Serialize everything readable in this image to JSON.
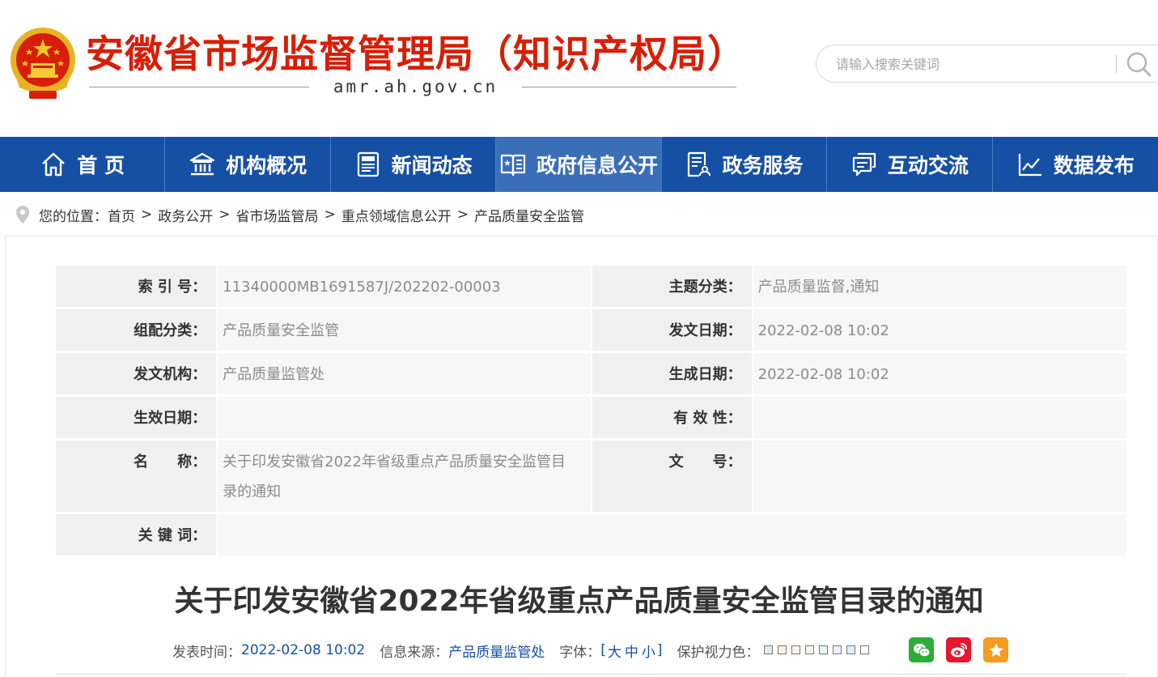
{
  "header": {
    "title": "安徽省市场监督管理局（知识产权局）",
    "domain": "amr.ah.gov.cn",
    "search": {
      "placeholder": "请输入搜索关键词"
    }
  },
  "nav": {
    "items": [
      {
        "label": "首 页",
        "icon": "home-icon"
      },
      {
        "label": "机构概况",
        "icon": "building-icon"
      },
      {
        "label": "新闻动态",
        "icon": "news-icon"
      },
      {
        "label": "政府信息公开",
        "icon": "open-book-icon",
        "active": true
      },
      {
        "label": "政务服务",
        "icon": "service-doc-icon"
      },
      {
        "label": "互动交流",
        "icon": "chat-icon"
      },
      {
        "label": "数据发布",
        "icon": "chart-icon"
      }
    ]
  },
  "breadcrumb": {
    "prefix": "您的位置：",
    "items": [
      "首页",
      "政务公开",
      "省市场监管局",
      "重点领域信息公开",
      "产品质量安全监管"
    ],
    "separator": ">"
  },
  "info": {
    "index_no_label": "索 引 号：",
    "index_no": "11340000MB1691587J/202202-00003",
    "topic_label": "主题分类：",
    "topic": "产品质量监督,通知",
    "category_label": "组配分类：",
    "category": "产品质量安全监管",
    "issue_date_label": "发文日期：",
    "issue_date": "2022-02-08 10:02",
    "issuer_label": "发文机构：",
    "issuer": "产品质量监管处",
    "created_label": "生成日期：",
    "created": "2022-02-08 10:02",
    "effective_label": "生效日期：",
    "effective": "",
    "validity_label": "有 效 性：",
    "validity": "",
    "name_label": "名　　称：",
    "name": "关于印发安徽省2022年省级重点产品质量安全监管目录的通知",
    "doc_no_label": "文　　号：",
    "doc_no": "",
    "keywords_label": "关 键 词：",
    "keywords": ""
  },
  "article": {
    "title": "关于印发安徽省2022年省级重点产品质量安全监管目录的通知",
    "publish_label": "发表时间：",
    "publish_time": "2022-02-08 10:02",
    "source_label": "信息来源：",
    "source": "产品质量监管处",
    "font_label": "字体：",
    "font_open": "[",
    "font_large": "大",
    "font_medium": "中",
    "font_small": "小",
    "font_close": "]",
    "eye_label": "保护视力色：",
    "eye_colors": [
      "#e8e8e8",
      "#fbf2e4",
      "#faf3f3",
      "#f3f7ea",
      "#eaf7ee",
      "#eaf0fb",
      "#e4ebf5",
      "#ffffff"
    ]
  },
  "share": {
    "wechat_icon": "wechat-icon",
    "weibo_icon": "weibo-icon",
    "favorite_icon": "star-icon"
  },
  "colors": {
    "brand_red": "#d81e06",
    "nav_blue": "#1650a5",
    "nav_active": "#3a6fb8",
    "link_blue": "#1650a5"
  }
}
